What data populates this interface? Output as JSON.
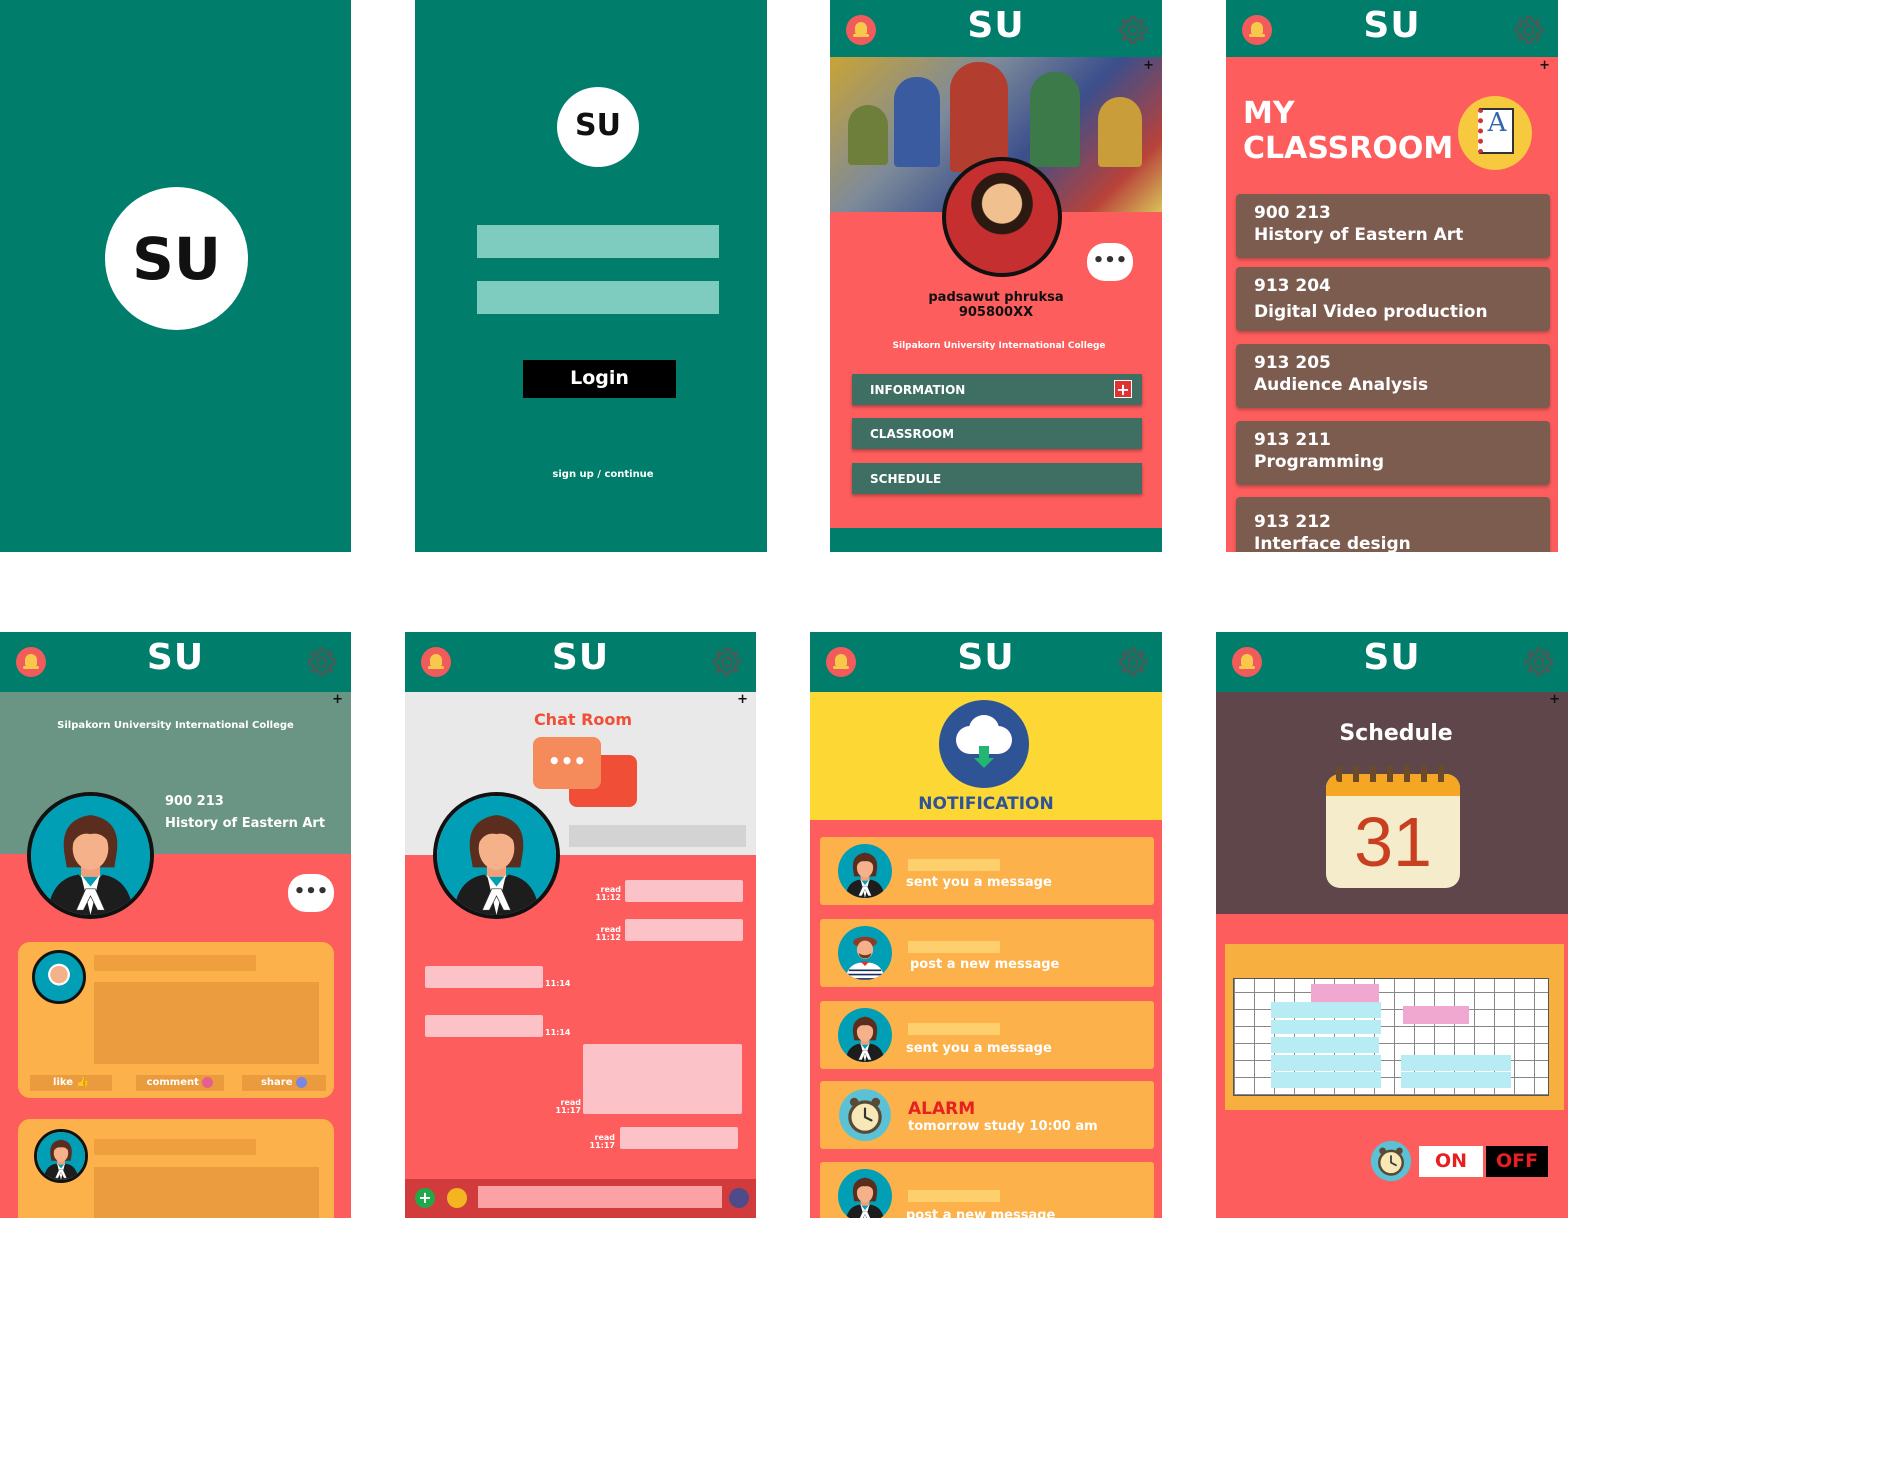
{
  "brand": {
    "logo_text": "SU",
    "teal": "#007d6b",
    "red": "#fd5d5c"
  },
  "login": {
    "login_label": "Login",
    "signup_link": "sign up / continue"
  },
  "profile": {
    "name": "padsawut phruksa",
    "student_id": "905800XX",
    "college": "Silpakorn University International College",
    "buttons": [
      "INFORMATION",
      "CLASSROOM",
      "SCHEDULE"
    ]
  },
  "classroom": {
    "title_line1": "MY",
    "title_line2": "CLASSROOM",
    "courses": [
      {
        "code": "900 213",
        "name": "History of Eastern Art"
      },
      {
        "code": "913 204",
        "name": "Digital Video production"
      },
      {
        "code": "913 205",
        "name": "Audience Analysis"
      },
      {
        "code": "913 211",
        "name": "Programming"
      },
      {
        "code": "913 212",
        "name": "Interface design"
      }
    ]
  },
  "course_feed": {
    "college": "Silpakorn University International College",
    "course_code": "900 213",
    "course_name": "History of Eastern Art",
    "actions": [
      "like",
      "comment",
      "share"
    ]
  },
  "chat": {
    "title": "Chat Room",
    "status": {
      "read1": "read",
      "time1": "11:12",
      "read2": "read",
      "time2": "11:12",
      "time3": "11:14",
      "time4": "11:14",
      "read5": "read",
      "time5": "11:17",
      "read6": "read",
      "time6": "11:17"
    }
  },
  "notification": {
    "title": "NOTIFICATION",
    "items": [
      {
        "text": "sent you a message"
      },
      {
        "text": "post a new message"
      },
      {
        "text": "sent you a message"
      },
      {
        "title": "ALARM",
        "text": "tomorrow study 10:00 am"
      },
      {
        "text": "post a new message"
      }
    ]
  },
  "schedule": {
    "title": "Schedule",
    "calendar_day": "31",
    "toggle_on": "ON",
    "toggle_off": "OFF"
  }
}
